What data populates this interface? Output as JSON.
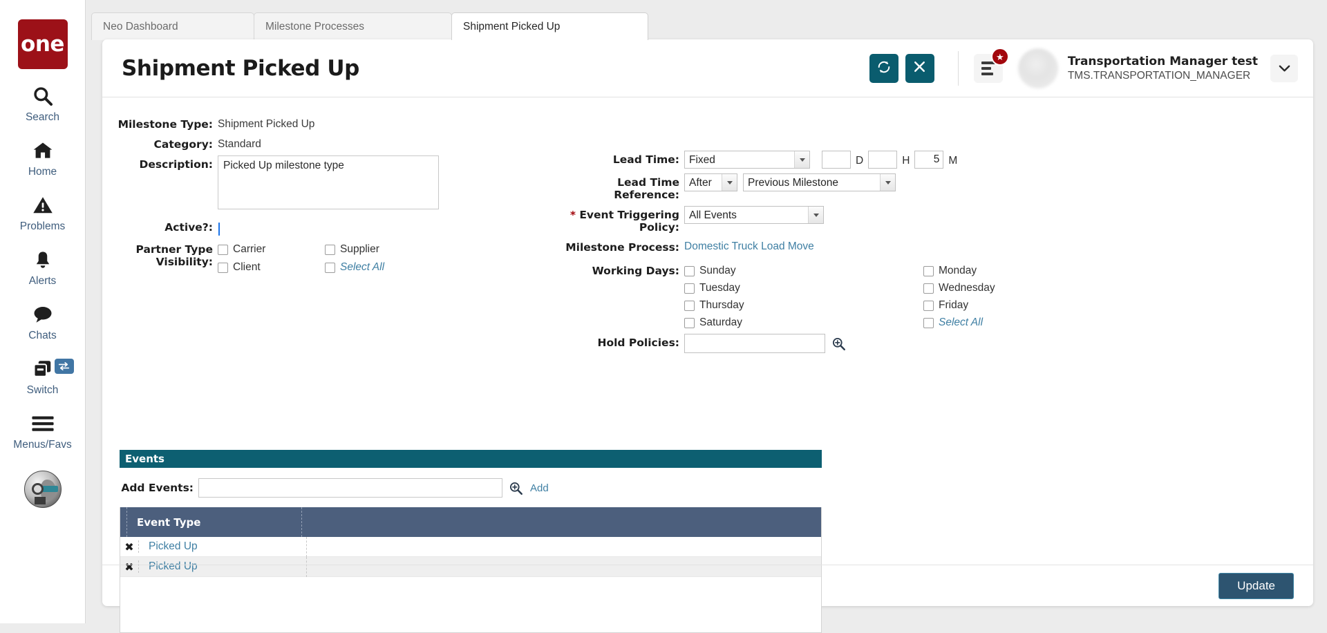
{
  "sidebar": {
    "brand": "one",
    "items": [
      {
        "label": "Search",
        "icon": "search-icon"
      },
      {
        "label": "Home",
        "icon": "home-icon"
      },
      {
        "label": "Problems",
        "icon": "warning-triangle-icon"
      },
      {
        "label": "Alerts",
        "icon": "bell-icon"
      },
      {
        "label": "Chats",
        "icon": "chat-bubble-icon"
      },
      {
        "label": "Switch",
        "icon": "switch-windows-icon",
        "badge_icon": "swap-arrows-icon"
      },
      {
        "label": "Menus/Favs",
        "icon": "hamburger-icon"
      }
    ],
    "avatar_icon": "ai-assistant-avatar"
  },
  "tabs": [
    {
      "label": "Neo Dashboard",
      "active": false,
      "closable": true
    },
    {
      "label": "Milestone Processes",
      "active": false,
      "closable": true
    },
    {
      "label": "Shipment Picked Up",
      "active": true,
      "closable": true
    }
  ],
  "header": {
    "title": "Shipment Picked Up",
    "refresh_icon": "refresh-icon",
    "close_icon": "close-icon",
    "menu_icon": "menu-list-icon",
    "badge_icon": "star-icon",
    "chevron_icon": "chevron-down-icon",
    "user": {
      "name": "Transportation Manager test",
      "role": "TMS.TRANSPORTATION_MANAGER"
    }
  },
  "form": {
    "milestone_type_label": "Milestone Type:",
    "milestone_type_value": "Shipment Picked Up",
    "category_label": "Category:",
    "category_value": "Standard",
    "description_label": "Description:",
    "description_value": "Picked Up milestone type",
    "active_label": "Active?:",
    "active_checked": true,
    "partner_type_label": "Partner Type Visibility:",
    "partner_types": [
      {
        "label": "Carrier",
        "checked": false,
        "select_all": false
      },
      {
        "label": "Supplier",
        "checked": false,
        "select_all": false
      },
      {
        "label": "Client",
        "checked": false,
        "select_all": false
      },
      {
        "label": "Select All",
        "checked": false,
        "select_all": true
      }
    ],
    "lead_time_label": "Lead Time:",
    "lead_time_type": "Fixed",
    "lead_time_days": "",
    "lead_time_days_unit": "D",
    "lead_time_hours": "",
    "lead_time_hours_unit": "H",
    "lead_time_minutes": "5",
    "lead_time_minutes_unit": "M",
    "lead_time_ref_label": "Lead Time Reference:",
    "lead_time_ref_direction": "After",
    "lead_time_ref_target": "Previous Milestone",
    "event_policy_label": "Event Triggering Policy:",
    "event_policy_required": "*",
    "event_policy_value": "All Events",
    "milestone_process_label": "Milestone Process:",
    "milestone_process_value": "Domestic Truck Load Move",
    "working_days_label": "Working Days:",
    "working_days": [
      {
        "label": "Sunday",
        "checked": false,
        "select_all": false
      },
      {
        "label": "Monday",
        "checked": false,
        "select_all": false
      },
      {
        "label": "Tuesday",
        "checked": false,
        "select_all": false
      },
      {
        "label": "Wednesday",
        "checked": false,
        "select_all": false
      },
      {
        "label": "Thursday",
        "checked": false,
        "select_all": false
      },
      {
        "label": "Friday",
        "checked": false,
        "select_all": false
      },
      {
        "label": "Saturday",
        "checked": false,
        "select_all": false
      },
      {
        "label": "Select All",
        "checked": false,
        "select_all": true
      }
    ],
    "hold_policies_label": "Hold Policies:",
    "hold_policies_value": "",
    "hold_policies_search_icon": "magnifier-plus-icon"
  },
  "events": {
    "panel_title": "Events",
    "add_events_label": "Add Events:",
    "add_events_value": "",
    "add_events_search_icon": "magnifier-plus-icon",
    "add_link": "Add",
    "columns": [
      "Event Type",
      ""
    ],
    "rows": [
      {
        "remove_icon": "remove-x-icon",
        "event_type": "Picked Up"
      },
      {
        "remove_icon": "remove-x-icon",
        "event_type": "Picked Up"
      }
    ]
  },
  "footer": {
    "update_label": "Update"
  },
  "colors": {
    "brand_red": "#9c1118",
    "teal": "#0a5c6e",
    "events_header": "#0d5f71",
    "table_header": "#4c5f7d",
    "link_blue": "#3f7fa3",
    "update_button": "#2d5470",
    "checkbox_checked": "#1a73e8"
  }
}
